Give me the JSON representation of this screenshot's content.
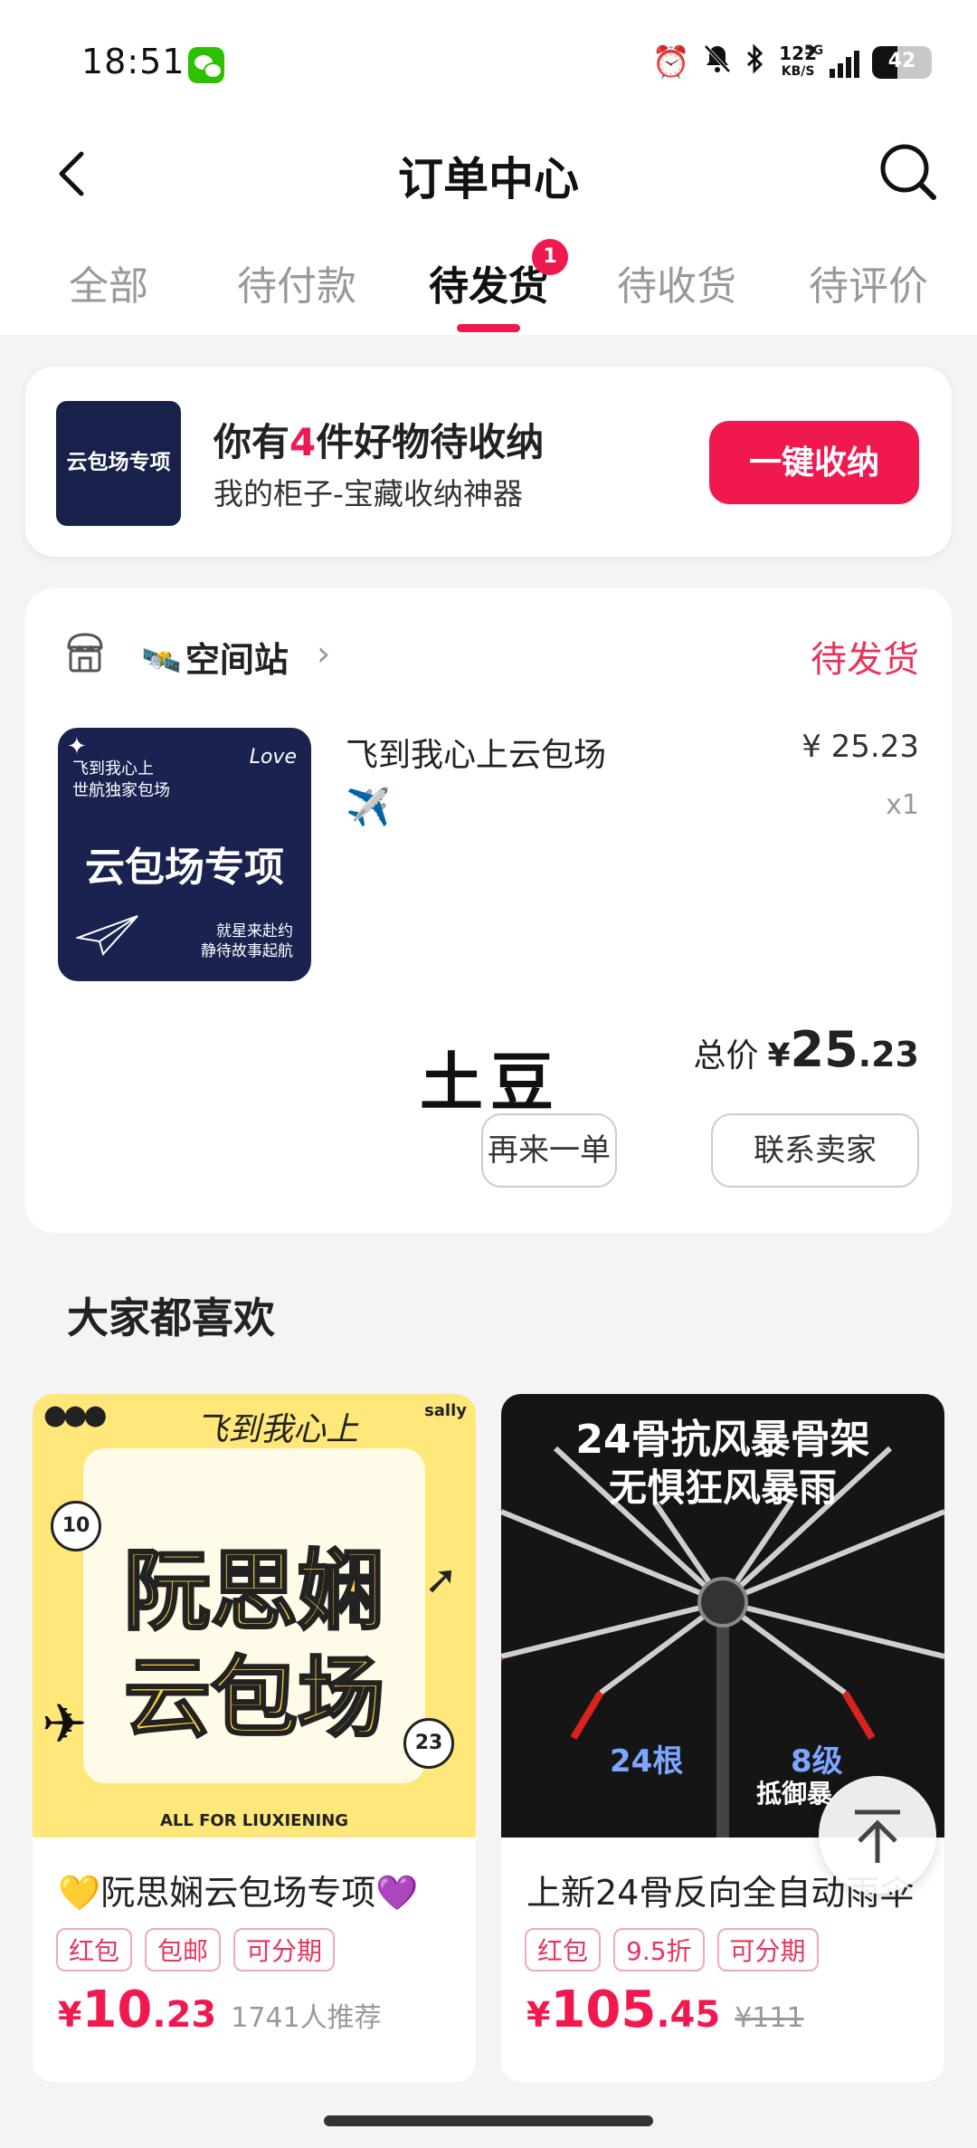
{
  "status_bar": {
    "time": "18:51",
    "net_speed": "122",
    "net_unit": "KB/S",
    "network": "5G",
    "battery": "42",
    "battery_level": 0.42
  },
  "header": {
    "title": "订单中心"
  },
  "tabs": [
    {
      "label": "全部",
      "active": false
    },
    {
      "label": "待付款",
      "active": false
    },
    {
      "label": "待发货",
      "active": true,
      "badge": "1"
    },
    {
      "label": "待收货",
      "active": false
    },
    {
      "label": "待评价",
      "active": false
    }
  ],
  "promo": {
    "thumb_text": "云包场专项",
    "title_prefix": "你有",
    "title_count": "4",
    "title_suffix": "件好物待收纳",
    "subtitle": "我的柜子-宝藏收纳神器",
    "button": "一键收纳"
  },
  "order": {
    "shop_emoji": "🛰️",
    "shop_name": "空间站",
    "status": "待发货",
    "thumb": {
      "main": "云包场专项",
      "top_text": "飞到我心上\n世航独家包场",
      "bottom_text": "就星来赴约\n静待故事起航",
      "love": "Love"
    },
    "item_name": "飞到我心上云包场",
    "item_emoji": "✈️",
    "price": "¥ 25.23",
    "quantity": "x1",
    "total_label": "总价",
    "total_currency": "¥",
    "total_int": "25",
    "total_dec": ".23",
    "handwritten": "土豆",
    "buttons": {
      "reorder": "再来一单",
      "contact": "联系卖家"
    }
  },
  "recommend": {
    "title": "大家都喜欢",
    "items": [
      {
        "image": {
          "line1": "阮思娴",
          "line2": "云包场",
          "n_left": "10",
          "n_right": "23",
          "brand": "sally",
          "bottom": "ALL FOR LIUXIENING"
        },
        "name": "💛阮思娴云包场专项💜",
        "tags": [
          "红包",
          "包邮",
          "可分期"
        ],
        "currency": "¥",
        "price_int": "10",
        "price_dec": ".23",
        "meta": "1741人推荐"
      },
      {
        "image": {
          "line1": "24骨抗风暴骨架",
          "line2": "无惧狂风暴雨",
          "badge1": "24根",
          "badge2": "8级",
          "badge3": "抵御暴"
        },
        "name": "上新24骨反向全自动雨伞",
        "tags": [
          "红包",
          "9.5折",
          "可分期"
        ],
        "currency": "¥",
        "price_int": "105",
        "price_dec": ".45",
        "old_price": "¥111"
      }
    ]
  },
  "icons": [
    "wechat-icon",
    "alarm-icon",
    "mute-icon",
    "bluetooth-icon",
    "signal-icon",
    "battery-icon",
    "back-icon",
    "search-icon",
    "shop-icon",
    "back-to-top-icon"
  ],
  "colors": {
    "accent": "#f0194f",
    "status": "#e8345b",
    "tag_border": "#f2a8bb"
  }
}
